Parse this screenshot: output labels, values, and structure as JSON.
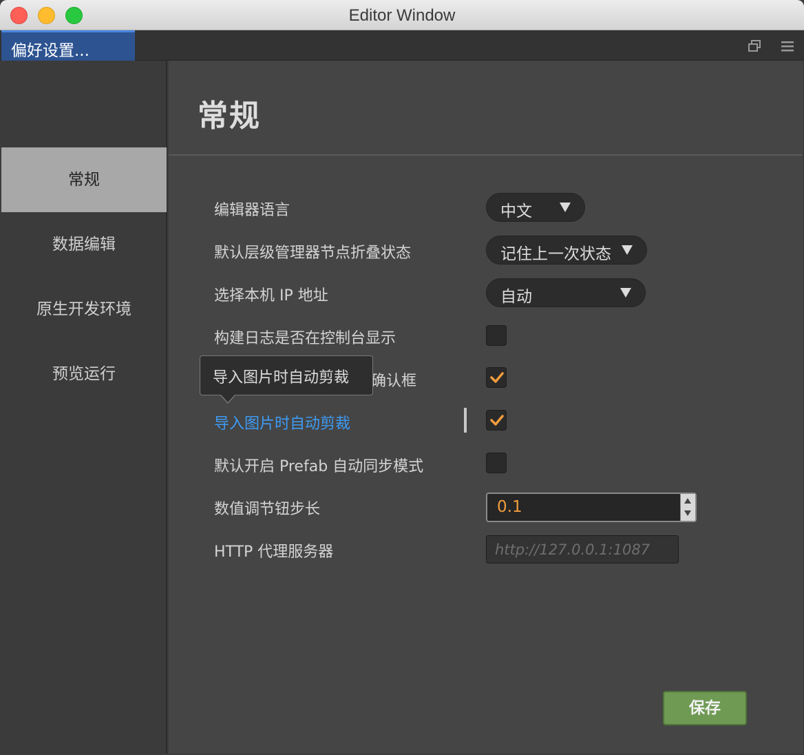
{
  "window": {
    "title": "Editor Window"
  },
  "tabbar": {
    "active_tab": "偏好设置..."
  },
  "sidebar": {
    "items": [
      {
        "label": "常规",
        "active": true
      },
      {
        "label": "数据编辑",
        "active": false
      },
      {
        "label": "原生开发环境",
        "active": false
      },
      {
        "label": "预览运行",
        "active": false
      }
    ]
  },
  "main": {
    "title": "常规",
    "settings": [
      {
        "label": "编辑器语言",
        "control": "select",
        "value": "中文"
      },
      {
        "label": "默认层级管理器节点折叠状态",
        "control": "select",
        "value": "记住上一次状态"
      },
      {
        "label": "选择本机 IP 地址",
        "control": "select",
        "value": "自动"
      },
      {
        "label": "构建日志是否在控制台显示",
        "control": "checkbox",
        "checked": false
      },
      {
        "label": "确认框",
        "control": "checkbox",
        "checked": true
      },
      {
        "label": "导入图片时自动剪裁",
        "control": "checkbox",
        "checked": true
      },
      {
        "label": "默认开启 Prefab 自动同步模式",
        "control": "checkbox",
        "checked": false
      },
      {
        "label": "数值调节钮步长",
        "control": "number",
        "value": "0.1"
      },
      {
        "label": "HTTP 代理服务器",
        "control": "text",
        "value": "",
        "placeholder": "http://127.0.0.1:1087"
      }
    ],
    "save_label": "保存"
  },
  "tooltip": {
    "text": "导入图片时自动剪裁"
  },
  "colors": {
    "accent_blue": "#3e9bf4",
    "tab_active_bg": "#2d5391",
    "checkmark": "#f29d3c",
    "save_button": "#6f9a53"
  }
}
